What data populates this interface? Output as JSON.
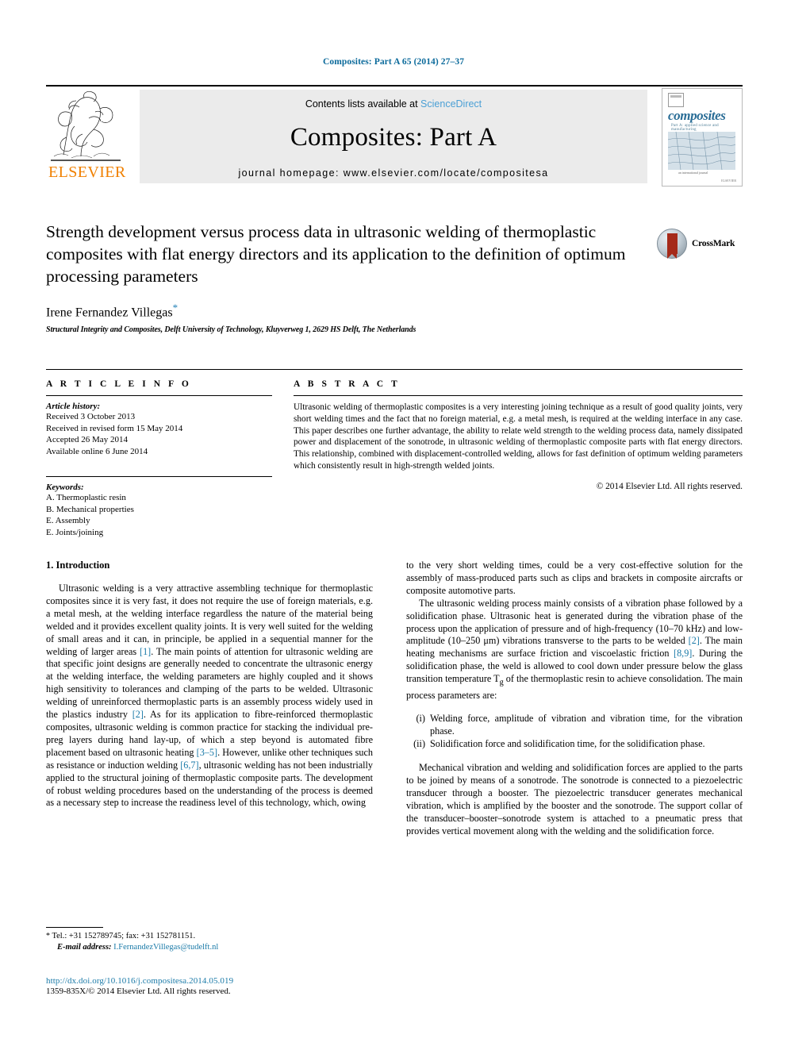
{
  "running_head": "Composites: Part A 65 (2014) 27–37",
  "masthead": {
    "contents_prefix": "Contents lists available at ",
    "sciencedirect": "ScienceDirect",
    "journal_title": "Composites: Part A",
    "homepage": "journal homepage: www.elsevier.com/locate/compositesa",
    "publisher_wordmark": "ELSEVIER",
    "cover": {
      "title": "composites",
      "subtitle": "Part A: applied science and manufacturing",
      "footer_small": "an international journal",
      "footer_brand": "ELSEVIER"
    },
    "colors": {
      "sciencedirect_blue": "#4a9fd5",
      "elsevier_orange": "#f08000",
      "panel_gray": "#ebebeb"
    }
  },
  "title_block": {
    "title": "Strength development versus process data in ultrasonic welding of thermoplastic composites with flat energy directors and its application to the definition of optimum processing parameters",
    "author": "Irene Fernandez Villegas",
    "author_marker": "*",
    "affiliation": "Structural Integrity and Composites, Delft University of Technology, Kluyverweg 1, 2629 HS Delft, The Netherlands",
    "crossmark_label": "CrossMark"
  },
  "article_info": {
    "section_label": "A R T I C L E   I N F O",
    "history_label": "Article history:",
    "history": [
      "Received 3 October 2013",
      "Received in revised form 15 May 2014",
      "Accepted 26 May 2014",
      "Available online 6 June 2014"
    ],
    "keywords_label": "Keywords:",
    "keywords": [
      "A. Thermoplastic resin",
      "B. Mechanical properties",
      "E. Assembly",
      "E. Joints/joining"
    ]
  },
  "abstract": {
    "section_label": "A B S T R A C T",
    "text": "Ultrasonic welding of thermoplastic composites is a very interesting joining technique as a result of good quality joints, very short welding times and the fact that no foreign material, e.g. a metal mesh, is required at the welding interface in any case. This paper describes one further advantage, the ability to relate weld strength to the welding process data, namely dissipated power and displacement of the sonotrode, in ultrasonic welding of thermoplastic composite parts with flat energy directors. This relationship, combined with displacement-controlled welding, allows for fast definition of optimum welding parameters which consistently result in high-strength welded joints.",
    "copyright": "© 2014 Elsevier Ltd. All rights reserved."
  },
  "body": {
    "section_heading": "1. Introduction",
    "left_p1_a": "Ultrasonic welding is a very attractive assembling technique for thermoplastic composites since it is very fast, it does not require the use of foreign materials, e.g. a metal mesh, at the welding interface regardless the nature of the material being welded and it provides excellent quality joints. It is very well suited for the welding of small areas and it can, in principle, be applied in a sequential manner for the welding of larger areas ",
    "ref1": "[1]",
    "left_p1_b": ". The main points of attention for ultrasonic welding are that specific joint designs are generally needed to concentrate the ultrasonic energy at the welding interface, the welding parameters are highly coupled and it shows high sensitivity to tolerances and clamping of the parts to be welded. Ultrasonic welding of unreinforced thermoplastic parts is an assembly process widely used in the plastics industry ",
    "ref2": "[2]",
    "left_p1_c": ". As for its application to fibre-reinforced thermoplastic composites, ultrasonic welding is common practice for stacking the individual pre-preg layers during hand lay-up, of which a step beyond is automated fibre placement based on ultrasonic heating ",
    "ref35": "[3–5]",
    "left_p1_d": ". However, unlike other techniques such as resistance or induction welding ",
    "ref67": "[6,7]",
    "left_p1_e": ", ultrasonic welding has not been industrially applied to the structural joining of thermoplastic composite parts. The development of robust welding procedures based on the understanding of the process is deemed as a necessary step to increase the readiness level of this technology, which, owing",
    "right_p1": "to the very short welding times, could be a very cost-effective solution for the assembly of mass-produced parts such as clips and brackets in composite aircrafts or composite automotive parts.",
    "right_p2_a": "The ultrasonic welding process mainly consists of a vibration phase followed by a solidification phase. Ultrasonic heat is generated during the vibration phase of the process upon the application of pressure and of high-frequency (10–70 kHz) and low-amplitude (10–250 μm) vibrations transverse to the parts to be welded ",
    "right_ref2": "[2]",
    "right_p2_b": ". The main heating mechanisms are surface friction and viscoelastic friction ",
    "right_ref89": "[8,9]",
    "right_p2_c": ". During the solidification phase, the weld is allowed to cool down under pressure below the glass transition temperature T",
    "right_p2_sub": "g",
    "right_p2_d": " of the thermoplastic resin to achieve consolidation. The main process parameters are:",
    "list_items": [
      {
        "marker": "(i)",
        "text": "Welding force, amplitude of vibration and vibration time, for the vibration phase."
      },
      {
        "marker": "(ii)",
        "text": "Solidification force and solidification time, for the solidification phase."
      }
    ],
    "right_p3": "Mechanical vibration and welding and solidification forces are applied to the parts to be joined by means of a sonotrode. The sonotrode is connected to a piezoelectric transducer through a booster. The piezoelectric transducer generates mechanical vibration, which is amplified by the booster and the sonotrode. The support collar of the transducer–booster–sonotrode system is attached to a pneumatic press that provides vertical movement along with the welding and the solidification force."
  },
  "footnote": {
    "marker": "*",
    "tel": "Tel.: +31 152789745; fax: +31 152781151.",
    "email_label": "E-mail address:",
    "email": "I.FernandezVillegas@tudelft.nl"
  },
  "footer": {
    "doi": "http://dx.doi.org/10.1016/j.compositesa.2014.05.019",
    "issn_line": "1359-835X/© 2014 Elsevier Ltd. All rights reserved."
  }
}
